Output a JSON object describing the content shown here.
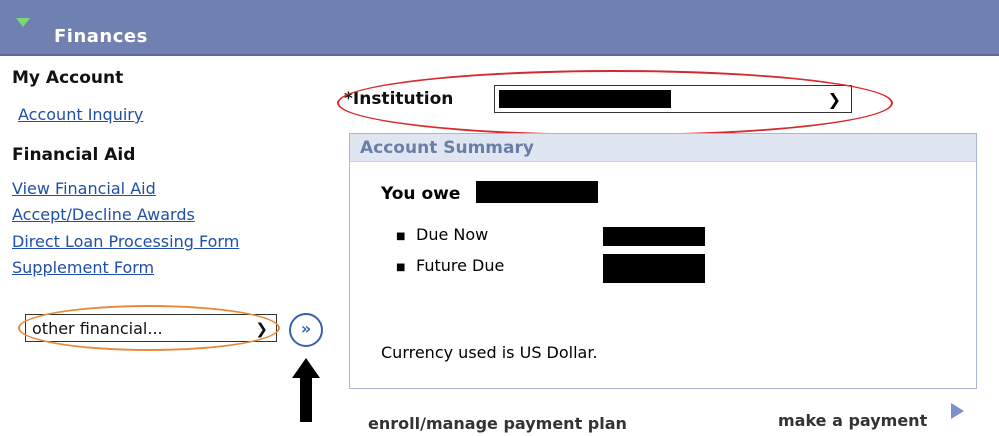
{
  "header": {
    "title": "Finances"
  },
  "nav": {
    "my_account": {
      "title": "My Account",
      "links": [
        "Account Inquiry"
      ]
    },
    "financial_aid": {
      "title": "Financial Aid",
      "links": [
        "View Financial Aid",
        "Accept/Decline Awards",
        "Direct Loan Processing Form",
        "Supplement Form"
      ]
    },
    "other_select": {
      "value": "other financial..."
    },
    "go_button": {
      "glyph": "»"
    }
  },
  "institution": {
    "label": "*Institution"
  },
  "summary": {
    "title": "Account Summary",
    "you_owe": "You owe",
    "items": [
      "Due Now",
      "Future Due"
    ],
    "currency_note": "Currency used is US Dollar."
  },
  "footer": {
    "payment_plan": "enroll/manage payment plan",
    "make_payment": "make a payment"
  },
  "colors": {
    "header_bg": "#7080b0",
    "link": "#1f4fa8",
    "summary_header_bg": "#dfe6f1",
    "annotation_red": "#d42a2a",
    "annotation_orange": "#e8893a"
  }
}
